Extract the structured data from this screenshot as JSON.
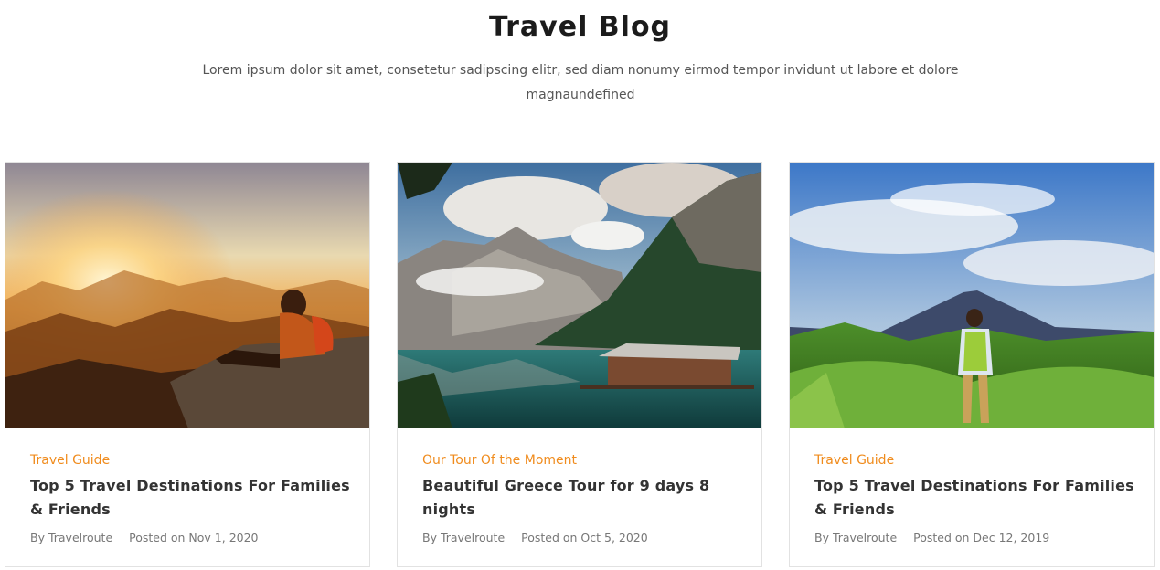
{
  "page": {
    "title": "Travel Blog",
    "subtitle": "Lorem ipsum dolor sit amet, consetetur sadipscing elitr, sed diam nonumy eirmod tempor invidunt ut labore et dolore magnaundefined"
  },
  "posts": [
    {
      "category": "Travel Guide",
      "title": "Top 5 Travel Destinations For Families & Friends",
      "author": "By Travelroute",
      "date": "Posted on Nov 1, 2020",
      "image": "hiker-sunset-mountain-photo"
    },
    {
      "category": "Our Tour Of the Moment",
      "title": "Beautiful Greece Tour for 9 days 8 nights",
      "author": "By Travelroute",
      "date": "Posted on Oct 5, 2020",
      "image": "mountain-lake-cabin-photo"
    },
    {
      "category": "Travel Guide",
      "title": "Top 5 Travel Destinations For Families & Friends",
      "author": "By Travelroute",
      "date": "Posted on Dec 12, 2019",
      "image": "hiker-volcano-valley-photo"
    }
  ],
  "colors": {
    "accent": "#f08c1e",
    "text": "#333333",
    "muted": "#777777"
  }
}
